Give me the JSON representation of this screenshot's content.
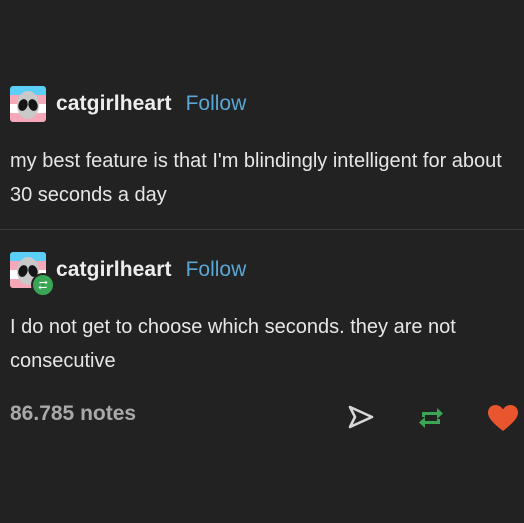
{
  "post1": {
    "username": "catgirlheart",
    "follow_label": "Follow",
    "text": "my best feature is that I'm blindingly intelligent for about 30 seconds a day"
  },
  "post2": {
    "username": "catgirlheart",
    "follow_label": "Follow",
    "text": "I do not get to choose which seconds. they are not consecutive"
  },
  "footer": {
    "notes": "86.785 notes"
  },
  "icons": {
    "share": "share-icon",
    "reblog": "reblog-icon",
    "like": "heart-icon"
  },
  "colors": {
    "background": "#222222",
    "follow": "#5aa7d6",
    "reblog": "#3aa655",
    "heart": "#e9552f"
  }
}
